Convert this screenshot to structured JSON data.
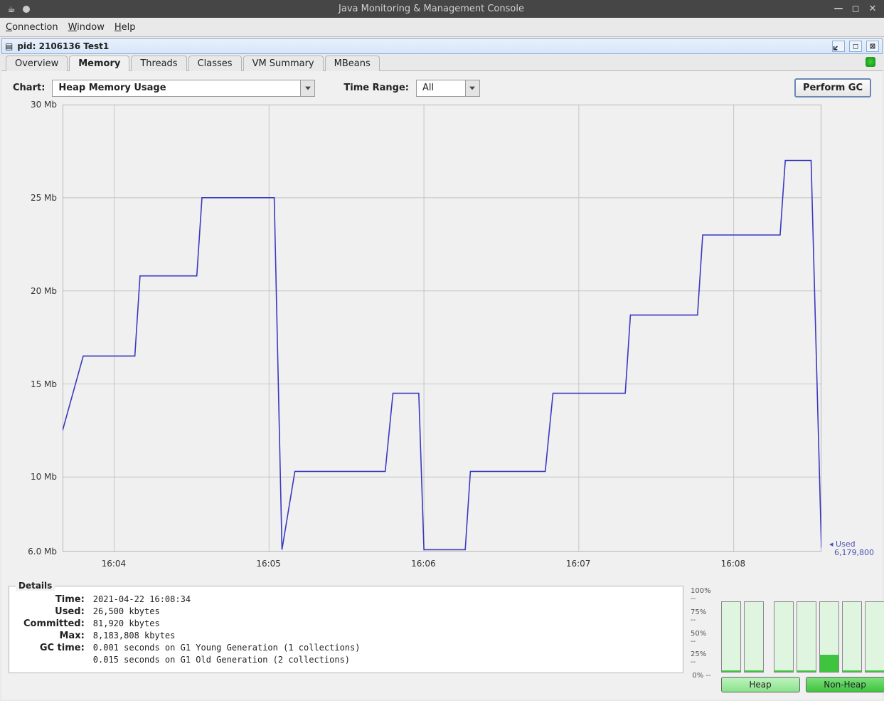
{
  "titlebar": {
    "title": "Java Monitoring & Management Console"
  },
  "menubar": {
    "connection": "Connection",
    "window": "Window",
    "help": "Help"
  },
  "internal_window": {
    "title": "pid: 2106136 Test1"
  },
  "tabs": {
    "overview": "Overview",
    "memory": "Memory",
    "threads": "Threads",
    "classes": "Classes",
    "vmsummary": "VM Summary",
    "mbeans": "MBeans"
  },
  "controls": {
    "chart_label": "Chart:",
    "chart_selected": "Heap Memory Usage",
    "timerange_label": "Time Range:",
    "timerange_selected": "All",
    "perform_gc": "Perform GC"
  },
  "y_ticks": [
    "30 Mb",
    "25 Mb",
    "20 Mb",
    "15 Mb",
    "10 Mb",
    "6.0 Mb"
  ],
  "x_ticks": [
    "16:04",
    "16:05",
    "16:06",
    "16:07",
    "16:08"
  ],
  "used_marker": {
    "label": "Used",
    "value": "6,179,800"
  },
  "details": {
    "heading": "Details",
    "time_label": "Time:",
    "time_value": "2021-04-22 16:08:34",
    "used_label": "Used:",
    "used_value": "26,500 kbytes",
    "committed_label": "Committed:",
    "committed_value": "81,920 kbytes",
    "max_label": "Max:",
    "max_value": "8,183,808 kbytes",
    "gc_label": "GC time:",
    "gc_line1": "0.001 seconds on G1 Young Generation (1 collections)",
    "gc_line2": "0.015 seconds on G1 Old Generation (2 collections)"
  },
  "bars": {
    "ylabels": [
      "100% --",
      "75% --",
      "50% --",
      "25% --",
      "0% --"
    ],
    "heap_label": "Heap",
    "nonheap_label": "Non-Heap",
    "heap_fills": [
      2,
      2
    ],
    "nonheap_fills": [
      2,
      2,
      24,
      2,
      2
    ]
  },
  "chart_data": {
    "type": "line",
    "title": "Heap Memory Usage",
    "xlabel": "",
    "ylabel": "Mb",
    "ylim": [
      6.0,
      30.0
    ],
    "x_ticks": [
      "16:04",
      "16:05",
      "16:06",
      "16:07",
      "16:08"
    ],
    "series": [
      {
        "name": "Used",
        "points": [
          {
            "t": "16:03:40",
            "v": 12.5
          },
          {
            "t": "16:03:48",
            "v": 16.5
          },
          {
            "t": "16:04:08",
            "v": 16.5
          },
          {
            "t": "16:04:10",
            "v": 20.8
          },
          {
            "t": "16:04:32",
            "v": 20.8
          },
          {
            "t": "16:04:34",
            "v": 25.0
          },
          {
            "t": "16:05:02",
            "v": 25.0
          },
          {
            "t": "16:05:05",
            "v": 6.1
          },
          {
            "t": "16:05:10",
            "v": 10.3
          },
          {
            "t": "16:05:45",
            "v": 10.3
          },
          {
            "t": "16:05:48",
            "v": 14.5
          },
          {
            "t": "16:05:58",
            "v": 14.5
          },
          {
            "t": "16:06:00",
            "v": 6.1
          },
          {
            "t": "16:06:16",
            "v": 6.1
          },
          {
            "t": "16:06:18",
            "v": 10.3
          },
          {
            "t": "16:06:47",
            "v": 10.3
          },
          {
            "t": "16:06:50",
            "v": 14.5
          },
          {
            "t": "16:07:18",
            "v": 14.5
          },
          {
            "t": "16:07:20",
            "v": 18.7
          },
          {
            "t": "16:07:46",
            "v": 18.7
          },
          {
            "t": "16:07:48",
            "v": 23.0
          },
          {
            "t": "16:08:18",
            "v": 23.0
          },
          {
            "t": "16:08:20",
            "v": 27.0
          },
          {
            "t": "16:08:30",
            "v": 27.0
          },
          {
            "t": "16:08:34",
            "v": 6.2
          }
        ]
      }
    ]
  }
}
